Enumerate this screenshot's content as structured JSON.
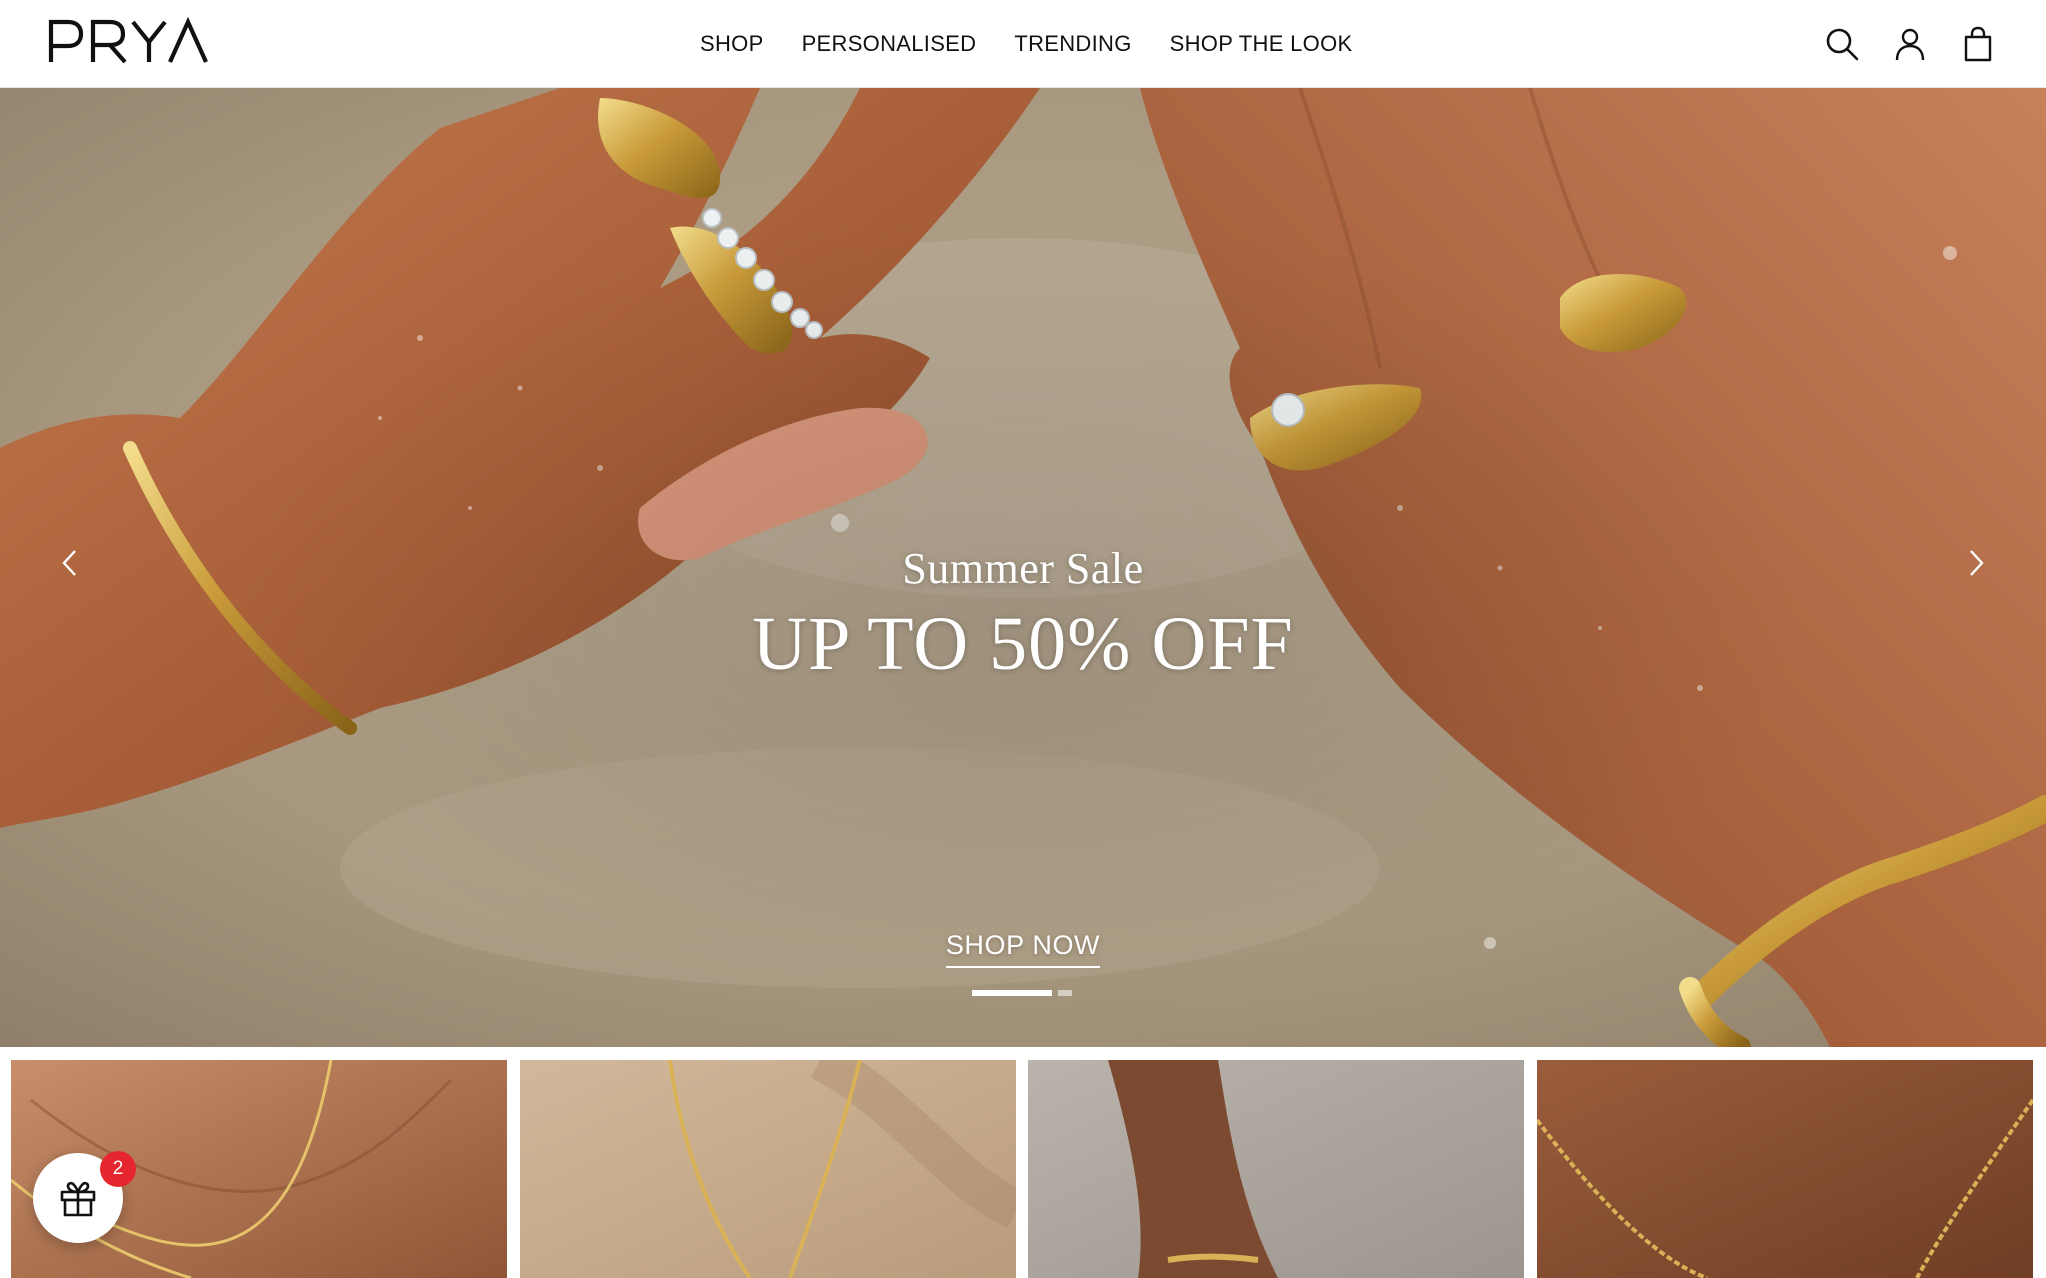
{
  "brand": {
    "logo_text": "PRYA"
  },
  "nav": {
    "items": [
      {
        "label": "SHOP"
      },
      {
        "label": "PERSONALISED"
      },
      {
        "label": "TRENDING"
      },
      {
        "label": "SHOP THE LOOK"
      }
    ]
  },
  "header_icons": {
    "search": "search-icon",
    "account": "account-icon",
    "cart": "shopping-bag-icon"
  },
  "hero": {
    "subtitle": "Summer Sale",
    "title": "UP TO 50% OFF",
    "cta_label": "SHOP NOW",
    "slides_total": 2,
    "active_slide": 1,
    "prev_icon": "chevron-left-icon",
    "next_icon": "chevron-right-icon"
  },
  "product_tiles": [
    {
      "icon": "necklace-on-neck-image"
    },
    {
      "icon": "necklace-on-sand-image"
    },
    {
      "icon": "anklet-image"
    },
    {
      "icon": "chain-necklace-image"
    }
  ],
  "gift_widget": {
    "icon": "gift-icon",
    "badge_count": "2"
  },
  "colors": {
    "text": "#111111",
    "badge": "#e5262e",
    "hero_text": "#ffffff"
  }
}
